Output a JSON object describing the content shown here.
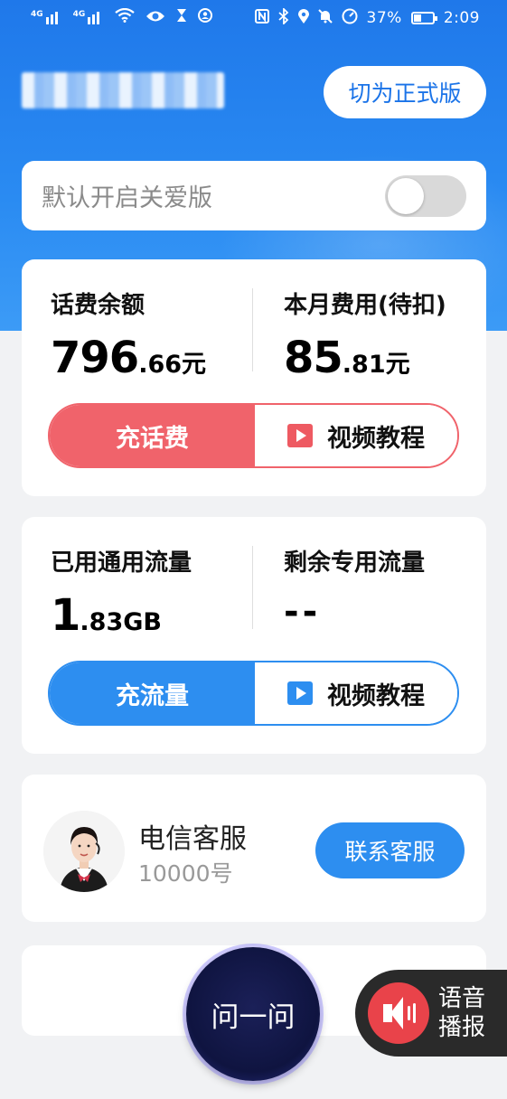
{
  "status_bar": {
    "signal1": "4G",
    "signal2": "4G",
    "battery_percent": "37%",
    "time": "2:09",
    "icons": [
      "signal-icon",
      "signal-icon",
      "wifi-icon",
      "eye-icon",
      "hourglass-icon",
      "shield-icon",
      "nfc-icon",
      "bluetooth-icon",
      "location-icon",
      "mute-icon",
      "speed-icon",
      "battery-icon"
    ]
  },
  "header": {
    "switch_label": "切为正式版"
  },
  "care_mode": {
    "label": "默认开启关爱版",
    "enabled": false
  },
  "balance_card": {
    "left_title": "话费余额",
    "left_amount_big": "796",
    "left_amount_small": ".66元",
    "right_title": "本月费用(待扣)",
    "right_amount_big": "85",
    "right_amount_small": ".81元",
    "primary_button": "充话费",
    "tutorial_button": "视频教程",
    "accent": "#f0636b"
  },
  "data_card": {
    "left_title": "已用通用流量",
    "left_amount_big": "1",
    "left_amount_small": ".83GB",
    "right_title": "剩余专用流量",
    "right_amount": "--",
    "primary_button": "充流量",
    "tutorial_button": "视频教程",
    "accent": "#2d8ef0"
  },
  "service": {
    "name": "电信客服",
    "number": "10000号",
    "button": "联系客服"
  },
  "floating": {
    "ask_label": "问一问",
    "speak_label": "语音播报"
  }
}
